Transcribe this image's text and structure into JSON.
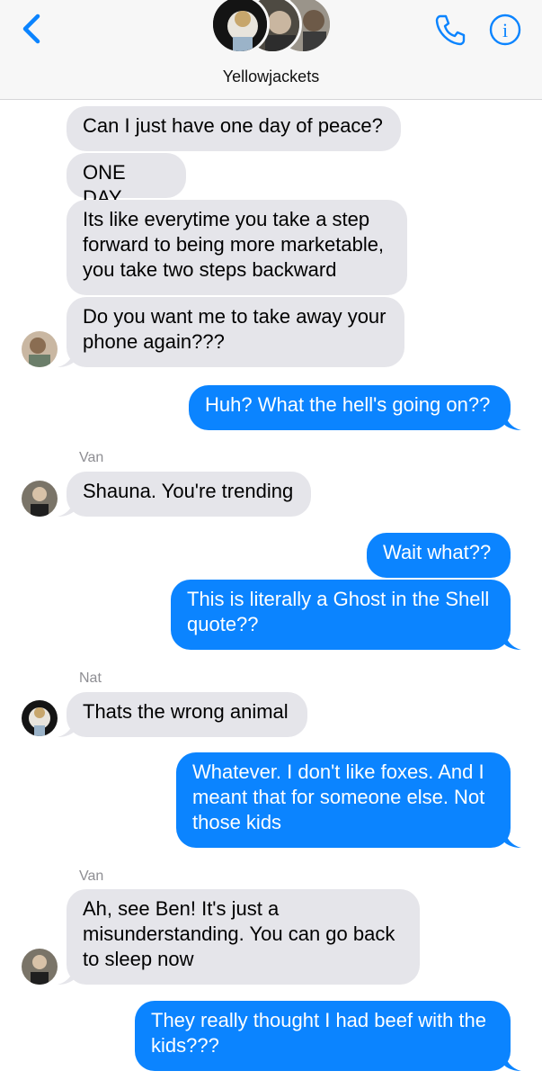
{
  "header": {
    "title": "Yellowjackets",
    "back_icon": "chevron-left-icon",
    "call_icon": "phone-icon",
    "info_icon": "info-icon",
    "accent": "#0b84ff"
  },
  "colors": {
    "incoming_bubble": "#e5e5ea",
    "outgoing_bubble": "#0b84ff"
  },
  "messages": [
    {
      "direction": "incoming",
      "text": "Can I just have one day of peace?"
    },
    {
      "direction": "incoming",
      "text": "ONE DAY"
    },
    {
      "direction": "incoming",
      "text": "Its like everytime you take a step\nforward to being more marketable,\nyou take two steps backward"
    },
    {
      "direction": "incoming",
      "text": "Do you want me to take away your\nphone again???"
    },
    {
      "direction": "outgoing",
      "text": "Huh? What the hell's going on??"
    },
    {
      "direction": "incoming",
      "sender": "Van",
      "text": "Shauna. You're trending"
    },
    {
      "direction": "outgoing",
      "text": "Wait what??"
    },
    {
      "direction": "outgoing",
      "text": "This is literally a Ghost in the Shell\nquote??"
    },
    {
      "direction": "incoming",
      "sender": "Nat",
      "text": "Thats the wrong animal"
    },
    {
      "direction": "outgoing",
      "text": "Whatever. I don't like foxes. And I\nmeant that for someone else. Not\nthose kids"
    },
    {
      "direction": "incoming",
      "sender": "Van",
      "text": "Ah, see Ben! It's just a\nmisunderstanding. You can go back\nto sleep now"
    },
    {
      "direction": "outgoing",
      "text": "They really thought I had beef with the\nkids???"
    }
  ]
}
